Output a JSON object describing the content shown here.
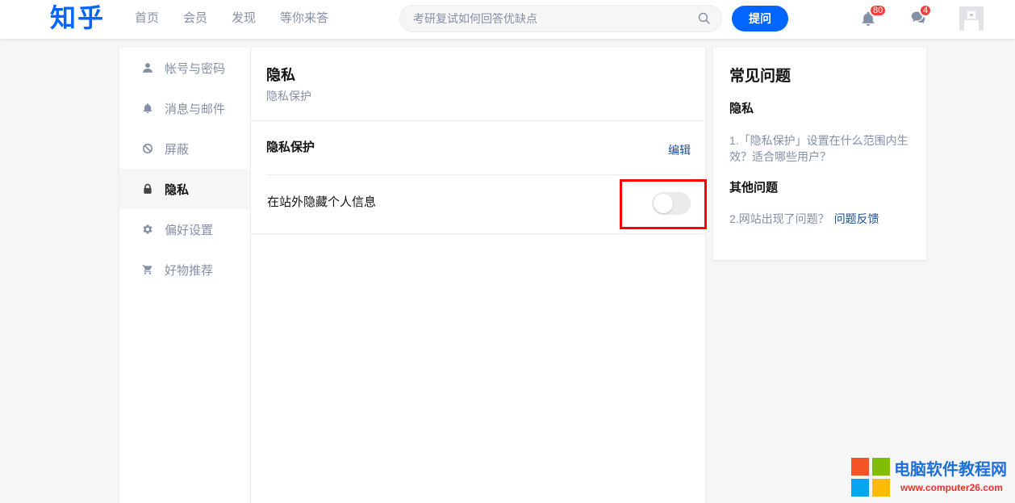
{
  "colors": {
    "brand": "#0066ff",
    "link": "#175199",
    "text": "#121212",
    "muted": "#8590a6",
    "badge": "#f1403c",
    "highlight": "#ff0000",
    "page_bg": "#f6f6f6",
    "watermark_blue": "#1f6fd8",
    "watermark_red": "#e8312b"
  },
  "header": {
    "logo": "知乎",
    "nav": [
      {
        "label": "首页"
      },
      {
        "label": "会员"
      },
      {
        "label": "发现"
      },
      {
        "label": "等你来答"
      }
    ],
    "search": {
      "placeholder": "考研复试如何回答优缺点",
      "value": "",
      "icon": "search-icon"
    },
    "ask_button": "提问",
    "notifications": {
      "icon": "bell-icon",
      "badge": "80"
    },
    "messages": {
      "icon": "chat-icon",
      "badge": "4"
    }
  },
  "sidebar": {
    "items": [
      {
        "label": "帐号与密码",
        "icon": "user-icon",
        "active": false
      },
      {
        "label": "消息与邮件",
        "icon": "bell-icon",
        "active": false
      },
      {
        "label": "屏蔽",
        "icon": "block-icon",
        "active": false
      },
      {
        "label": "隐私",
        "icon": "lock-icon",
        "active": true
      },
      {
        "label": "偏好设置",
        "icon": "gear-icon",
        "active": false
      },
      {
        "label": "好物推荐",
        "icon": "cart-icon",
        "active": false
      }
    ]
  },
  "main": {
    "title": "隐私",
    "subtitle": "隐私保护",
    "section": {
      "title": "隐私保护",
      "edit_label": "编辑",
      "settings": [
        {
          "label": "在站外隐藏个人信息",
          "enabled": false
        }
      ]
    }
  },
  "faq": {
    "title": "常见问题",
    "groups": [
      {
        "heading": "隐私",
        "items": [
          {
            "text": "1.「隐私保护」设置在什么范围内生效？适合哪些用户？"
          }
        ]
      },
      {
        "heading": "其他问题",
        "items": [
          {
            "text": "2.网站出现了问题？",
            "link": "问题反馈"
          }
        ]
      }
    ]
  },
  "watermark": {
    "title": "电脑软件教程网",
    "url": "www.computer26.com"
  }
}
